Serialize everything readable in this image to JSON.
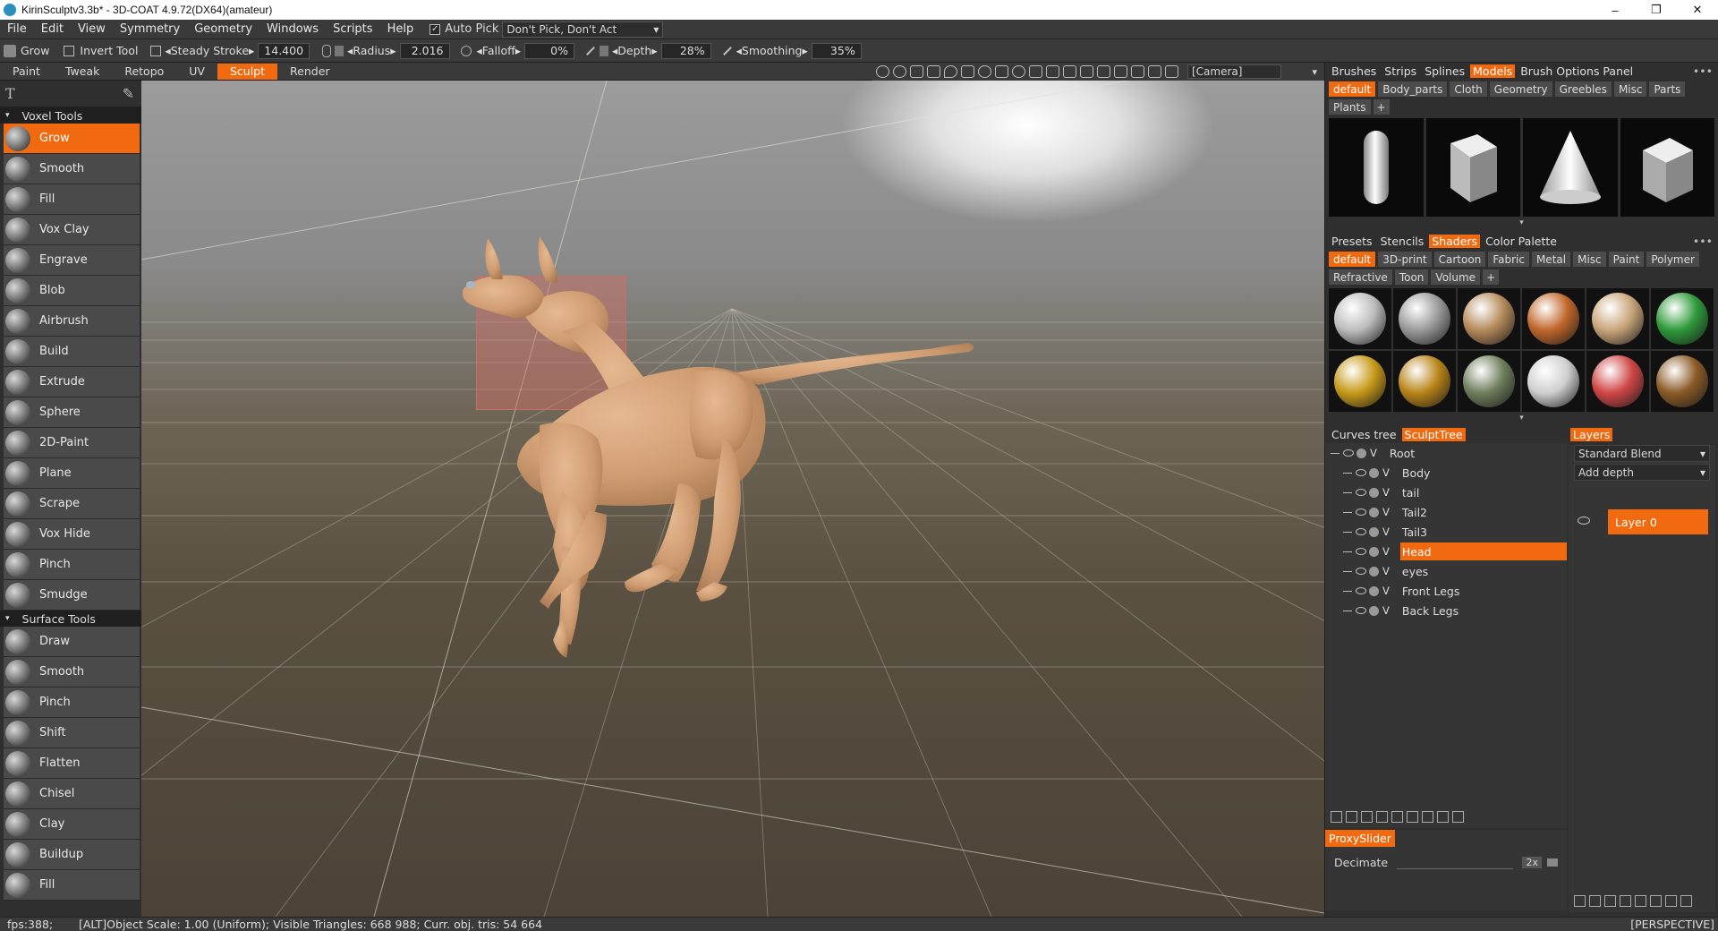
{
  "window": {
    "title": "KirinSculptv3.3b* - 3D-COAT 4.9.72(DX64)(amateur)",
    "min_glyph": "–",
    "max_glyph": "❐",
    "close_glyph": "✕"
  },
  "menubar": {
    "items": [
      "File",
      "Edit",
      "View",
      "Symmetry",
      "Geometry",
      "Windows",
      "Scripts",
      "Help"
    ],
    "auto_pick_label": "Auto  Pick",
    "auto_pick_checked": true,
    "pick_mode": "Don't  Pick,  Don't  Act",
    "checkmark": "✓",
    "arrow": "▾"
  },
  "toolbar": {
    "tool_name": "Grow",
    "invert_label": "Invert  Tool",
    "steady_label": "◂Steady  Stroke▸",
    "steady_value": "14.400",
    "radius_label": "◂Radius▸",
    "radius_value": "2.016",
    "falloff_label": "◂Falloff▸",
    "falloff_value": "0%",
    "depth_label": "◂Depth▸",
    "depth_value": "28%",
    "smoothing_label": "◂Smoothing▸",
    "smoothing_value": "35%"
  },
  "rooms": {
    "items": [
      "Paint",
      "Tweak",
      "Retopo",
      "UV",
      "Sculpt",
      "Render"
    ],
    "active": "Sculpt"
  },
  "viewport": {
    "camera": "[Camera]",
    "camera_arrow": "▾",
    "projection": "[PERSPECTIVE]"
  },
  "left_panel": {
    "text_tool_glyph": "T",
    "brush_glyph": "✎",
    "collapse_glyph": "▾",
    "voxel_header": "Voxel  Tools",
    "voxel_tools": [
      "Grow",
      "Smooth",
      "Fill",
      "Vox  Clay",
      "Engrave",
      "Blob",
      "Airbrush",
      "Build",
      "Extrude",
      "Sphere",
      "2D-Paint",
      "Plane",
      "Scrape",
      "Vox  Hide",
      "Pinch",
      "Smudge"
    ],
    "active_tool": "Grow",
    "surface_header": "Surface  Tools",
    "surface_tools": [
      "Draw",
      "Smooth",
      "Pinch",
      "Shift",
      "Flatten",
      "Chisel",
      "Clay",
      "Buildup",
      "Fill"
    ]
  },
  "models_panel": {
    "tabs": [
      "Brushes",
      "Strips",
      "Splines",
      "Models",
      "Brush  Options  Panel"
    ],
    "active_tab": "Models",
    "menu_glyph": "•••",
    "more_glyph": "▾",
    "categories": [
      "default",
      "Body_parts",
      "Cloth",
      "Geometry",
      "Greebles",
      "Misc",
      "Parts",
      "Plants"
    ],
    "active_category": "default",
    "add_glyph": "+",
    "thumbnails": [
      "capsule",
      "cube",
      "cone",
      "box"
    ]
  },
  "shaders_panel": {
    "tabs": [
      "Presets",
      "Stencils",
      "Shaders",
      "Color  Palette"
    ],
    "active_tab": "Shaders",
    "categories": [
      "default",
      "3D-print",
      "Cartoon",
      "Fabric",
      "Metal",
      "Misc",
      "Paint",
      "Polymer",
      "Refractive",
      "Toon",
      "Volume"
    ],
    "active_category": "default",
    "balls": [
      "#bdbdbd",
      "#9a9a9a",
      "#b58a5a",
      "#c0662a",
      "#c9a57a",
      "#2e9a3a",
      "#c79a18",
      "#b88418",
      "#6f7e5c",
      "#cfcfcf",
      "#d04646",
      "#8a5a26"
    ]
  },
  "tree_panel": {
    "tabs": [
      "Curves  tree",
      "SculptTree"
    ],
    "active_tab": "SculptTree",
    "visibility_letter": "V",
    "root": "Root",
    "nodes": [
      "Body",
      "tail",
      "Tail2",
      "Tail3",
      "Head",
      "eyes",
      "Front  Legs",
      "Back  Legs"
    ],
    "active_node": "Head"
  },
  "layers_panel": {
    "tab": "Layers",
    "blend": "Standard  Blend",
    "depth_mode": "Add  depth",
    "dropdown_arrow": "▾",
    "layer_name": "Layer  0"
  },
  "proxy_panel": {
    "tab": "ProxySlider",
    "label": "Decimate",
    "factor": "2x"
  },
  "status": {
    "fps": "fps:388;",
    "info": "[ALT]Object  Scale:  1.00  (Uniform);  Visible  Triangles:  668  988;  Curr.  obj.  tris:  54  664"
  },
  "colors": {
    "accent": "#f26a10",
    "body": "#d6a57a"
  }
}
